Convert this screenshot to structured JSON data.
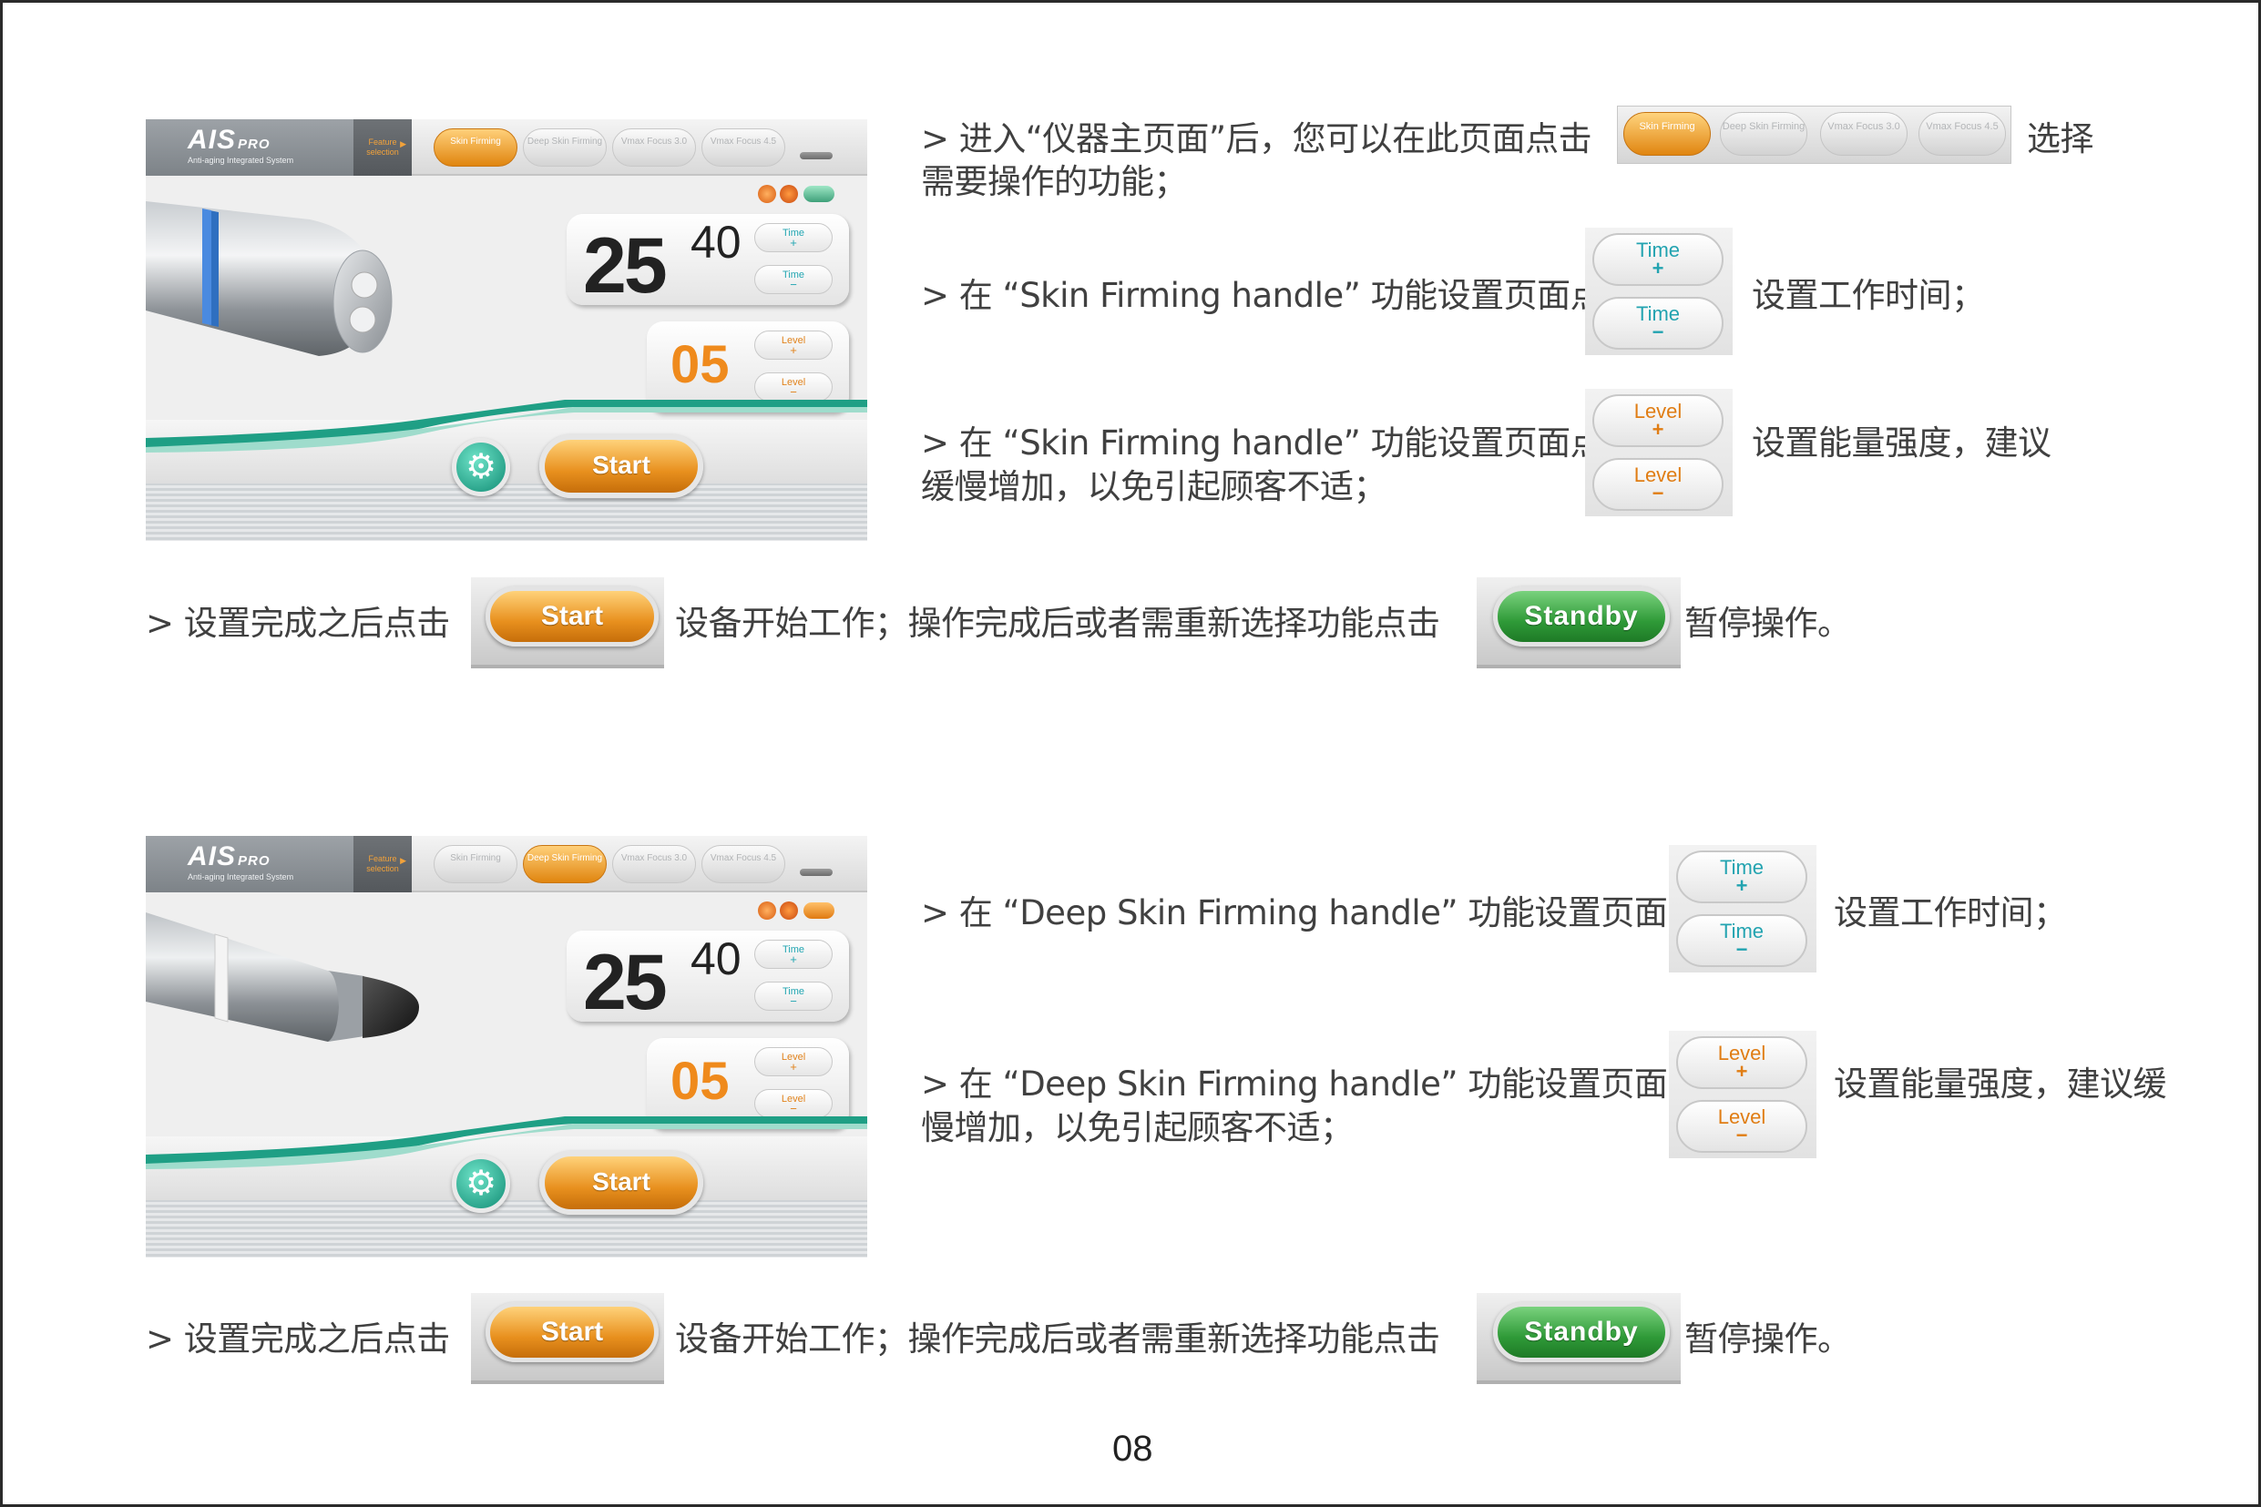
{
  "device": {
    "logo": "AIS",
    "logo_suffix": "PRO",
    "logo_sub": "Anti-aging Integrated System",
    "feature": "Feature selection",
    "tabs": [
      "Skin Firming",
      "Deep Skin Firming",
      "Vmax Focus 3.0",
      "Vmax Focus 4.5"
    ],
    "timer_min": "25",
    "timer_sec": "40",
    "level": "05",
    "time_btn": "Time",
    "level_btn": "Level",
    "plus": "+",
    "minus": "−",
    "start": "Start",
    "standby": "Standby"
  },
  "section1": {
    "line1_a": "> 进入“仪器主页面”后，您可以在此页面点击",
    "line1_b": "选择",
    "line1_c": "需要操作的功能；",
    "line2_a": "> 在 “Skin Firming handle” 功能设置页面点击",
    "line2_b": "设置工作时间；",
    "line3_a": "> 在 “Skin Firming handle” 功能设置页面点击",
    "line3_b": "设置能量强度，建议",
    "line3_c": "缓慢增加，以免引起顾客不适；",
    "line4_a": "> 设置完成之后点击",
    "line4_b": "设备开始工作；操作完成后或者需重新选择功能点击",
    "line4_c": "暂停操作。"
  },
  "section2": {
    "line1_a": "> 在 “Deep Skin Firming handle” 功能设置页面点击",
    "line1_b": "设置工作时间；",
    "line2_a": "> 在 “Deep Skin Firming handle” 功能设置页面点击",
    "line2_b": "设置能量强度，建议缓",
    "line2_c": "慢增加，以免引起顾客不适；",
    "line3_a": "> 设置完成之后点击",
    "line3_b": "设备开始工作；操作完成后或者需重新选择功能点击",
    "line3_c": "暂停操作。"
  },
  "page_number": "08",
  "colors": {
    "orange": "#e8901e",
    "teal": "#22a3b0",
    "green": "#2f9a38"
  }
}
